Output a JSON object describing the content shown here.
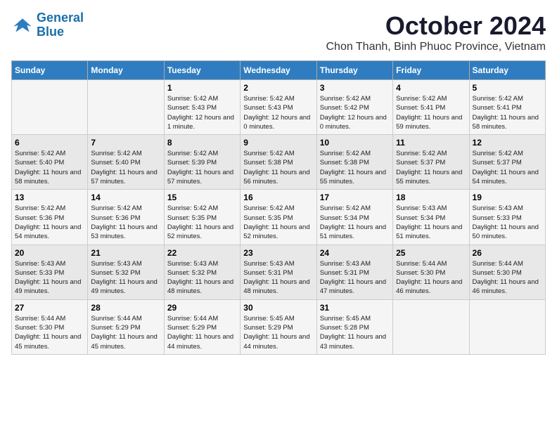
{
  "logo": {
    "line1": "General",
    "line2": "Blue"
  },
  "title": "October 2024",
  "location": "Chon Thanh, Binh Phuoc Province, Vietnam",
  "weekdays": [
    "Sunday",
    "Monday",
    "Tuesday",
    "Wednesday",
    "Thursday",
    "Friday",
    "Saturday"
  ],
  "weeks": [
    [
      {
        "day": "",
        "info": ""
      },
      {
        "day": "",
        "info": ""
      },
      {
        "day": "1",
        "info": "Sunrise: 5:42 AM\nSunset: 5:43 PM\nDaylight: 12 hours and 1 minute."
      },
      {
        "day": "2",
        "info": "Sunrise: 5:42 AM\nSunset: 5:43 PM\nDaylight: 12 hours and 0 minutes."
      },
      {
        "day": "3",
        "info": "Sunrise: 5:42 AM\nSunset: 5:42 PM\nDaylight: 12 hours and 0 minutes."
      },
      {
        "day": "4",
        "info": "Sunrise: 5:42 AM\nSunset: 5:41 PM\nDaylight: 11 hours and 59 minutes."
      },
      {
        "day": "5",
        "info": "Sunrise: 5:42 AM\nSunset: 5:41 PM\nDaylight: 11 hours and 58 minutes."
      }
    ],
    [
      {
        "day": "6",
        "info": "Sunrise: 5:42 AM\nSunset: 5:40 PM\nDaylight: 11 hours and 58 minutes."
      },
      {
        "day": "7",
        "info": "Sunrise: 5:42 AM\nSunset: 5:40 PM\nDaylight: 11 hours and 57 minutes."
      },
      {
        "day": "8",
        "info": "Sunrise: 5:42 AM\nSunset: 5:39 PM\nDaylight: 11 hours and 57 minutes."
      },
      {
        "day": "9",
        "info": "Sunrise: 5:42 AM\nSunset: 5:38 PM\nDaylight: 11 hours and 56 minutes."
      },
      {
        "day": "10",
        "info": "Sunrise: 5:42 AM\nSunset: 5:38 PM\nDaylight: 11 hours and 55 minutes."
      },
      {
        "day": "11",
        "info": "Sunrise: 5:42 AM\nSunset: 5:37 PM\nDaylight: 11 hours and 55 minutes."
      },
      {
        "day": "12",
        "info": "Sunrise: 5:42 AM\nSunset: 5:37 PM\nDaylight: 11 hours and 54 minutes."
      }
    ],
    [
      {
        "day": "13",
        "info": "Sunrise: 5:42 AM\nSunset: 5:36 PM\nDaylight: 11 hours and 54 minutes."
      },
      {
        "day": "14",
        "info": "Sunrise: 5:42 AM\nSunset: 5:36 PM\nDaylight: 11 hours and 53 minutes."
      },
      {
        "day": "15",
        "info": "Sunrise: 5:42 AM\nSunset: 5:35 PM\nDaylight: 11 hours and 52 minutes."
      },
      {
        "day": "16",
        "info": "Sunrise: 5:42 AM\nSunset: 5:35 PM\nDaylight: 11 hours and 52 minutes."
      },
      {
        "day": "17",
        "info": "Sunrise: 5:42 AM\nSunset: 5:34 PM\nDaylight: 11 hours and 51 minutes."
      },
      {
        "day": "18",
        "info": "Sunrise: 5:43 AM\nSunset: 5:34 PM\nDaylight: 11 hours and 51 minutes."
      },
      {
        "day": "19",
        "info": "Sunrise: 5:43 AM\nSunset: 5:33 PM\nDaylight: 11 hours and 50 minutes."
      }
    ],
    [
      {
        "day": "20",
        "info": "Sunrise: 5:43 AM\nSunset: 5:33 PM\nDaylight: 11 hours and 49 minutes."
      },
      {
        "day": "21",
        "info": "Sunrise: 5:43 AM\nSunset: 5:32 PM\nDaylight: 11 hours and 49 minutes."
      },
      {
        "day": "22",
        "info": "Sunrise: 5:43 AM\nSunset: 5:32 PM\nDaylight: 11 hours and 48 minutes."
      },
      {
        "day": "23",
        "info": "Sunrise: 5:43 AM\nSunset: 5:31 PM\nDaylight: 11 hours and 48 minutes."
      },
      {
        "day": "24",
        "info": "Sunrise: 5:43 AM\nSunset: 5:31 PM\nDaylight: 11 hours and 47 minutes."
      },
      {
        "day": "25",
        "info": "Sunrise: 5:44 AM\nSunset: 5:30 PM\nDaylight: 11 hours and 46 minutes."
      },
      {
        "day": "26",
        "info": "Sunrise: 5:44 AM\nSunset: 5:30 PM\nDaylight: 11 hours and 46 minutes."
      }
    ],
    [
      {
        "day": "27",
        "info": "Sunrise: 5:44 AM\nSunset: 5:30 PM\nDaylight: 11 hours and 45 minutes."
      },
      {
        "day": "28",
        "info": "Sunrise: 5:44 AM\nSunset: 5:29 PM\nDaylight: 11 hours and 45 minutes."
      },
      {
        "day": "29",
        "info": "Sunrise: 5:44 AM\nSunset: 5:29 PM\nDaylight: 11 hours and 44 minutes."
      },
      {
        "day": "30",
        "info": "Sunrise: 5:45 AM\nSunset: 5:29 PM\nDaylight: 11 hours and 44 minutes."
      },
      {
        "day": "31",
        "info": "Sunrise: 5:45 AM\nSunset: 5:28 PM\nDaylight: 11 hours and 43 minutes."
      },
      {
        "day": "",
        "info": ""
      },
      {
        "day": "",
        "info": ""
      }
    ]
  ]
}
